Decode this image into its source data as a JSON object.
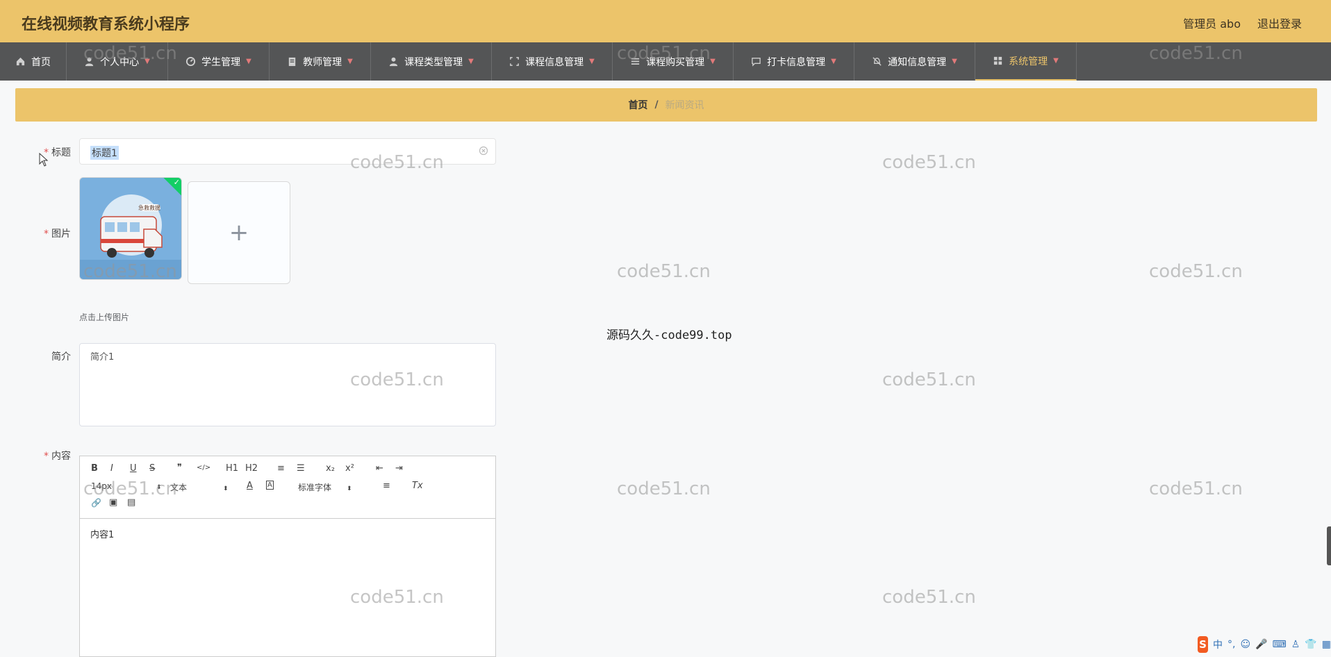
{
  "header": {
    "title": "在线视频教育系统小程序",
    "admin": "管理员 abo",
    "logout": "退出登录"
  },
  "nav": [
    {
      "label": "首页",
      "icon": "home-icon"
    },
    {
      "label": "个人中心",
      "icon": "user-icon"
    },
    {
      "label": "学生管理",
      "icon": "gauge-icon"
    },
    {
      "label": "教师管理",
      "icon": "clipboard-icon"
    },
    {
      "label": "课程类型管理",
      "icon": "user-icon"
    },
    {
      "label": "课程信息管理",
      "icon": "frame-icon"
    },
    {
      "label": "课程购买管理",
      "icon": "list-icon"
    },
    {
      "label": "打卡信息管理",
      "icon": "chat-icon"
    },
    {
      "label": "通知信息管理",
      "icon": "bell-off-icon"
    },
    {
      "label": "系统管理",
      "icon": "grid-icon"
    }
  ],
  "breadcrumb": {
    "home": "首页",
    "separator": "/",
    "current": "新闻资讯"
  },
  "form": {
    "title_label": "标题",
    "title_value": "标题1",
    "image_label": "图片",
    "image_hint": "点击上传图片",
    "image_badge": "急救救援",
    "upload_plus": "+",
    "intro_label": "简介",
    "intro_value": "简介1",
    "content_label": "内容",
    "content_value": "内容1",
    "required_mark": "*"
  },
  "editor_toolbar": {
    "bold": "B",
    "italic": "I",
    "underline": "U",
    "strike": "S",
    "quote": "❞",
    "code": "</>",
    "h1": "H1",
    "h2": "H2",
    "ordered_list": "≡",
    "bullet_list": "☰",
    "subscript": "x₂",
    "superscript": "x²",
    "outdent": "⇤",
    "indent": "⇥",
    "size": "14px",
    "block": "文本",
    "font_color": "A",
    "bg_color": "A",
    "font_family": "标准字体",
    "align": "≡",
    "clear_format": "Tx",
    "link": "🔗",
    "image": "▣",
    "video": "▤"
  },
  "watermarks": {
    "text": "code51.cn",
    "center_note": "源码久久-code99.top"
  },
  "ime": {
    "logo": "S",
    "lang": "中",
    "punct": "°,",
    "emoji": "☺",
    "mic": "🎤",
    "keyboard": "⌨",
    "user": "♙",
    "shirt": "👕",
    "apps": "▦"
  },
  "colors": {
    "header_bg": "#ecc46a",
    "nav_bg": "#545556",
    "accent": "#ecc46a",
    "required": "#e05050"
  }
}
